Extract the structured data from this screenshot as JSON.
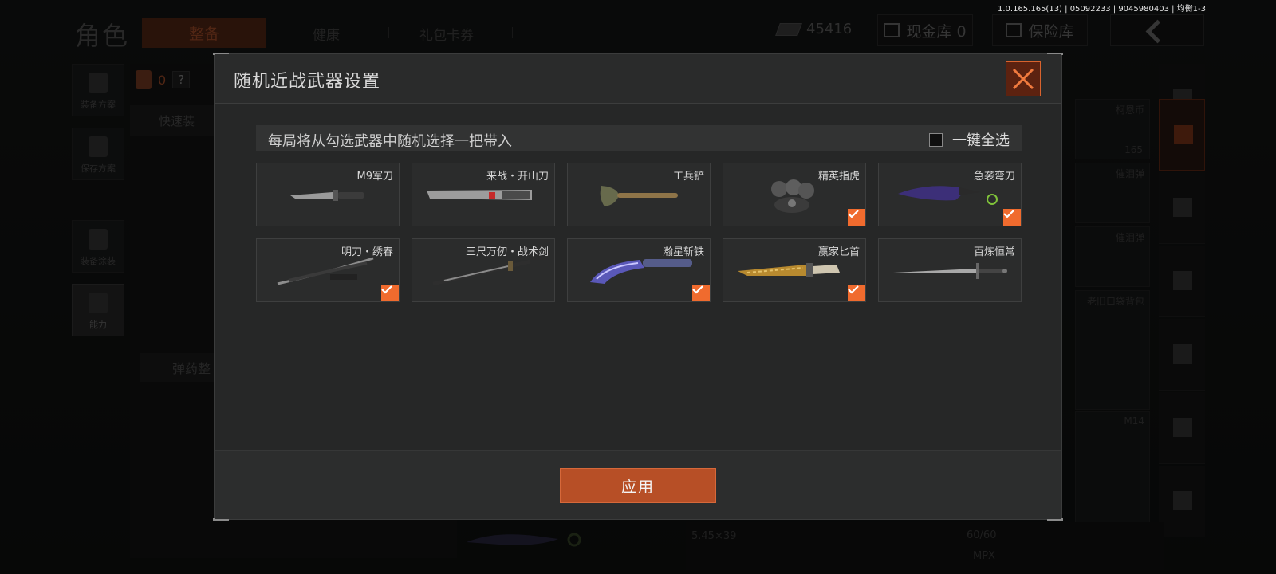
{
  "version_text": "1.0.165.165(13) | 05092233 | 9045980403 | 均衡1-3",
  "background": {
    "page_title": "角色",
    "tabs": [
      {
        "label": "整备",
        "active": true
      },
      {
        "label": "健康",
        "active": false
      },
      {
        "label": "礼包卡券",
        "active": false
      }
    ],
    "currency_amount": "45416",
    "cash_vault_label": "现金库 0",
    "safe_box_label": "保险库",
    "left_buttons": [
      {
        "label": "装备方案"
      },
      {
        "label": "保存方案"
      },
      {
        "label": "装备涂装"
      },
      {
        "label": "能力"
      }
    ],
    "bag_count": "0",
    "help_symbol": "?",
    "quick_equip_label": "快速装",
    "ammo_label": "弹药整",
    "inventory": [
      {
        "label": "柯恩币",
        "count": "165"
      },
      {
        "label": "催泪弹",
        "count": ""
      },
      {
        "label": "催泪弹",
        "count": ""
      },
      {
        "label": "老旧口袋背包",
        "count": ""
      },
      {
        "label": "M14",
        "count": ""
      }
    ],
    "bottom_caliber": "5.45×39",
    "bottom_ammo": "60/60",
    "bottom_weapon": "MPX"
  },
  "modal": {
    "title": "随机近战武器设置",
    "instruction": "每局将从勾选武器中随机选择一把带入",
    "select_all_label": "一键全选",
    "select_all_checked": false,
    "weapons": [
      {
        "name": "M9军刀",
        "checked": false,
        "icon": "bayonet-knife"
      },
      {
        "name": "来战・开山刀",
        "checked": false,
        "icon": "machete"
      },
      {
        "name": "工兵铲",
        "checked": false,
        "icon": "shovel"
      },
      {
        "name": "精英指虎",
        "checked": true,
        "icon": "brass-knuckles"
      },
      {
        "name": "急袭弯刀",
        "checked": true,
        "icon": "karambit"
      },
      {
        "name": "明刀・绣春",
        "checked": true,
        "icon": "curved-sword"
      },
      {
        "name": "三尺万仞・战术剑",
        "checked": false,
        "icon": "tactical-sword"
      },
      {
        "name": "瀚星斩铁",
        "checked": true,
        "icon": "kukri"
      },
      {
        "name": "赢家匕首",
        "checked": true,
        "icon": "gold-dagger"
      },
      {
        "name": "百炼恒常",
        "checked": false,
        "icon": "long-sword"
      }
    ],
    "apply_label": "应用"
  },
  "colors": {
    "accent": "#f06b2e",
    "apply": "#b74f26",
    "modal_bg": "#262727"
  }
}
